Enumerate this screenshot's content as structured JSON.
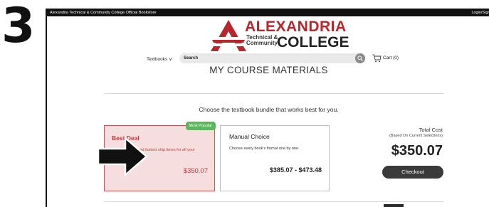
{
  "step": {
    "number": "3"
  },
  "topbar": {
    "store_title": "Alexandria Technical & Community College Official Bookstore",
    "login_label": "Login/Sign Up"
  },
  "logo": {
    "word_top": "ALEXANDRIA",
    "small_line1": "Technical &",
    "small_line2": "Community",
    "word_bottom": "COLLEGE",
    "brand_color": "#b5272d"
  },
  "nav": {
    "textbooks_label": "Textbooks ∨",
    "search_placeholder": "Search",
    "cart_label": "Cart (0)"
  },
  "page": {
    "heading": "MY COURSE MATERIALS",
    "choose_text": "Choose the textbook bundle that works best for you."
  },
  "options": {
    "best_deal": {
      "badge": "Most Popular",
      "title": "Best Deal",
      "description": "The best price and fastest ship times for all your materials.",
      "price": "$350.07",
      "selected": true
    },
    "manual_choice": {
      "title": "Manual Choice",
      "description": "Choose every book's format one by one.",
      "price": "$385.07 - $473.48"
    }
  },
  "summary": {
    "total_label": "Total Cost",
    "total_sub": "(Based On Current Selections)",
    "total_amount": "$350.07",
    "checkout_label": "Checkout"
  },
  "colors": {
    "selected_border": "#c85555",
    "selected_bg": "#f6dede",
    "badge_green": "#5cb85c",
    "checkout_bg": "#3a3a3a"
  }
}
